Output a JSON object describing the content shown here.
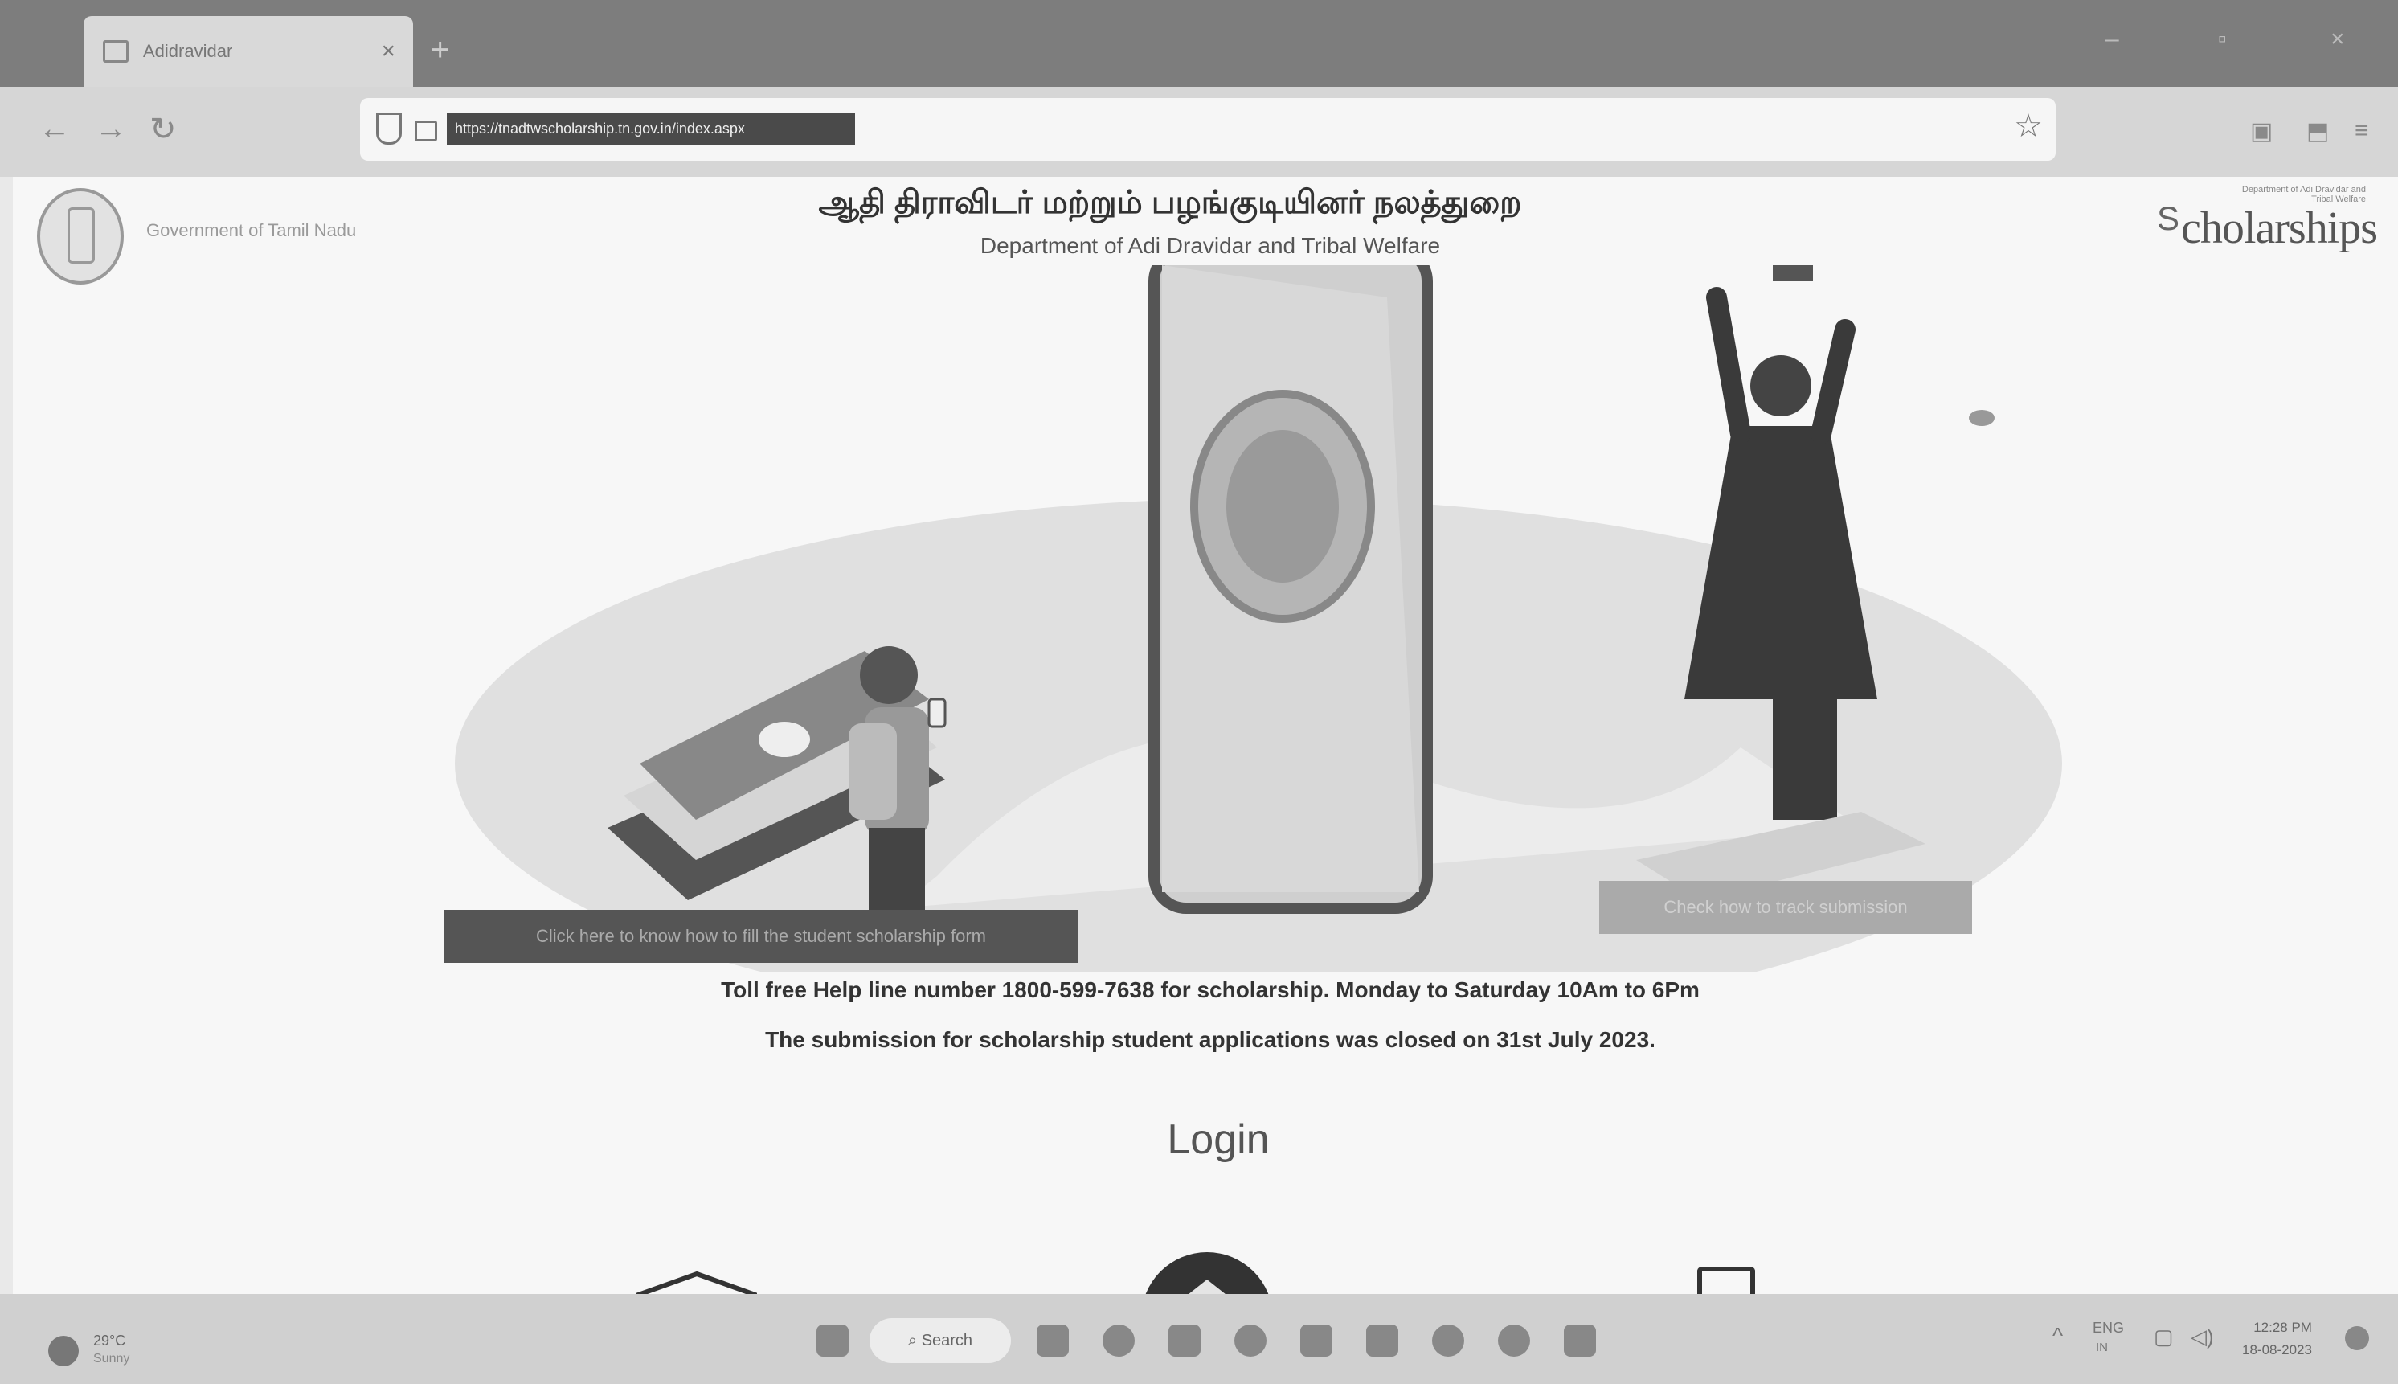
{
  "browser": {
    "tab_title": "Adidravidar",
    "new_tab": "+",
    "close_tab": "×",
    "url": "https://tnadtwscholarship.tn.gov.in/index.aspx",
    "window_min": "–",
    "window_max": "▫",
    "window_close": "×"
  },
  "header": {
    "govt_label": "Government of Tamil Nadu",
    "tamil_title": "ஆதி திராவிடர் மற்றும் பழங்குடியினர் நலத்துறை",
    "dept_title": "Department of Adi Dravidar and Tribal Welfare",
    "scholarships_small": "Department of Adi Dravidar and Tribal Welfare",
    "scholarships_brand": "cholarships",
    "scholarships_cap": "S"
  },
  "main": {
    "howto_button": "Click here to know how to fill the student scholarship form",
    "status_button": "Check how to track submission",
    "helpline": "Toll free Help line number 1800-599-7638 for scholarship. Monday to Saturday 10Am to 6Pm",
    "closed_notice": "The submission for scholarship student applications was closed on 31st July 2023.",
    "login_heading": "Login"
  },
  "taskbar": {
    "temp": "29°C",
    "weather": "Sunny",
    "search_label": "Search",
    "lang": "ENG",
    "lang_region": "IN",
    "time": "12:28 PM",
    "date": "18-08-2023"
  },
  "colors": {
    "tabbar": "#7d7d7d",
    "navbar": "#d6d6d6",
    "page_bg": "#f7f7f7",
    "primary_button": "#555555",
    "secondary_button": "#aaaaaa"
  }
}
